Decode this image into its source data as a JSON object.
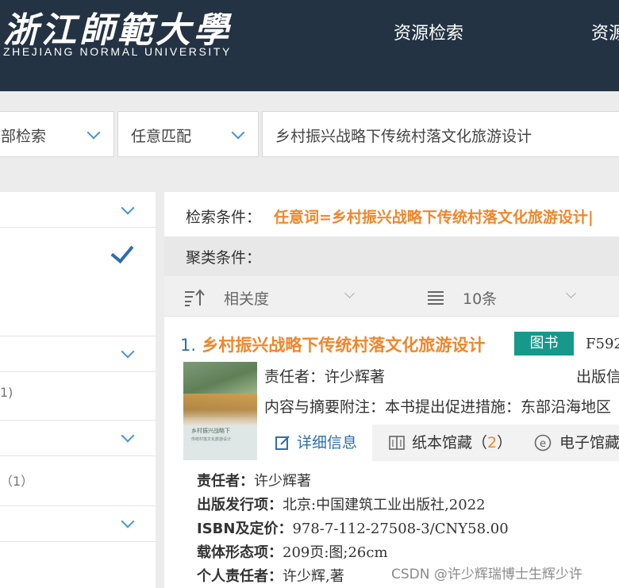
{
  "header": {
    "logo_cn": "浙江師範大學",
    "logo_en": "ZHEJIANG NORMAL UNIVERSITY",
    "nav": [
      "资源检索",
      "资源"
    ]
  },
  "search": {
    "scope": "部检索",
    "match": "任意匹配",
    "query": "乡村振兴战略下传统村落文化旅游设计"
  },
  "left": {
    "counts": [
      "1)",
      "（1）"
    ]
  },
  "conditions": {
    "search_label": "检索条件：",
    "search_value": "任意词=乡村振兴战略下传统村落文化旅游设计|",
    "cluster_label": "聚类条件："
  },
  "sort": {
    "order": "相关度",
    "per_page": "10条"
  },
  "result": {
    "number": "1.",
    "title": "乡村振兴战略下传统村落文化旅游设计",
    "badge": "图书",
    "code": "F592",
    "responsible": "责任者：许少辉著",
    "publisher_info": "出版信",
    "summary": "内容与摘要附注：本书提出促进措施：东部沿海地区",
    "cover_title": "乡村振兴战略下",
    "cover_subtitle": "传统村落文化旅游设计",
    "tabs": {
      "detail": "详细信息",
      "paper": "纸本馆藏（",
      "paper_count": "2",
      "paper_close": "）",
      "electronic": "电子馆藏"
    },
    "details": [
      {
        "key": "责任者：",
        "value": "许少辉著"
      },
      {
        "key": "出版发行项：",
        "value": "北京:中国建筑工业出版社,2022"
      },
      {
        "key": "ISBN及定价：",
        "value": "978-7-112-27508-3/CNY58.00"
      },
      {
        "key": "载体形态项：",
        "value": "209页:图;26cm"
      },
      {
        "key": "个人责任者：",
        "value": "许少辉,著"
      }
    ]
  },
  "watermark": "CSDN @许少辉瑞博士生辉少许"
}
